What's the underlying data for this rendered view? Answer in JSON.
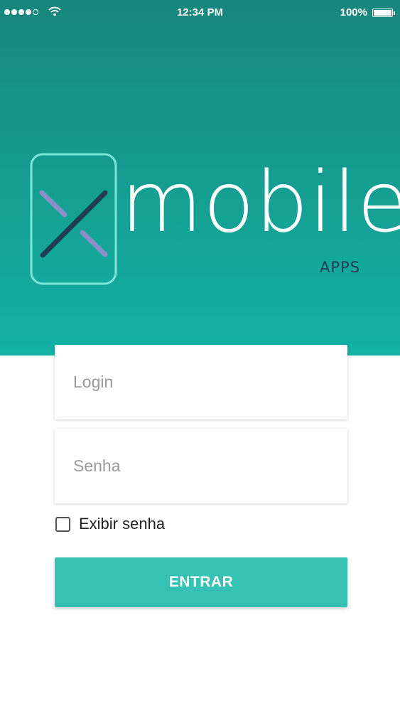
{
  "status_bar": {
    "time": "12:34 PM",
    "battery_percent": "100%",
    "signal_bars_filled": 4,
    "signal_bars_total": 5,
    "icons": [
      "signal-dots-icon",
      "wifi-icon",
      "battery-icon"
    ]
  },
  "logo": {
    "wordmark": "mobile",
    "tagline": "APPS",
    "mark_letter": "X",
    "icon": "x-phone-logo-icon"
  },
  "form": {
    "login_placeholder": "Login",
    "password_placeholder": "Senha",
    "show_password_label": "Exibir senha",
    "show_password_checked": false,
    "submit_label": "ENTRAR"
  },
  "colors": {
    "header_gradient_top": "#17867c",
    "header_gradient_bottom": "#12b2a5",
    "button": "#35c1b4",
    "logo_frame": "#7ee6d8",
    "logo_x_dark": "#1d3d55",
    "logo_x_light": "#8a8fc7",
    "tagline": "#1d3d55"
  }
}
